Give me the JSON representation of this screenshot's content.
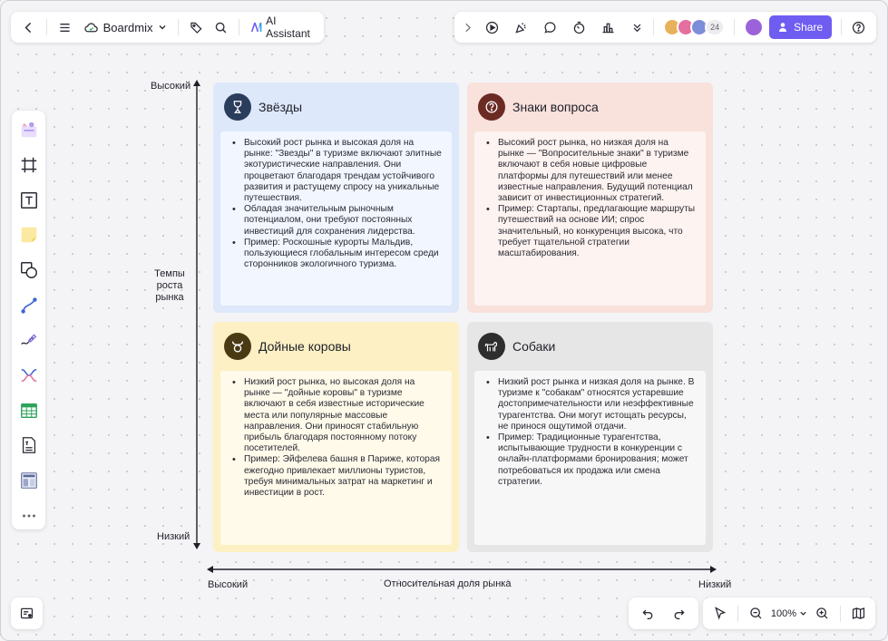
{
  "app": {
    "workspace": "Boardmix",
    "ai_label": "AI Assistant",
    "share_label": "Share",
    "collaborator_count": "24",
    "zoom": "100%",
    "colors": {
      "accent": "#6f5cf1"
    }
  },
  "toolbar_left": [
    {
      "name": "back-icon"
    },
    {
      "name": "menu-icon"
    },
    {
      "name": "cloud-icon"
    },
    {
      "name": "tag-icon"
    },
    {
      "name": "search-icon"
    },
    {
      "name": "ai-logo-icon"
    }
  ],
  "toolbar_right": [
    {
      "name": "chevron-right-icon"
    },
    {
      "name": "play-icon"
    },
    {
      "name": "celebrate-icon"
    },
    {
      "name": "comment-icon"
    },
    {
      "name": "timer-icon"
    },
    {
      "name": "vote-icon"
    },
    {
      "name": "chevron-down-double-icon"
    },
    {
      "name": "help-icon"
    }
  ],
  "sidebar_tools": [
    "templates-icon",
    "frame-icon",
    "text-icon",
    "sticky-note-icon",
    "shapes-icon",
    "connector-icon",
    "pen-icon",
    "mindmap-icon",
    "table-icon",
    "document-icon",
    "layout-icon",
    "more-icon"
  ],
  "matrix": {
    "y_axis": {
      "label": "Темпы\nроста\nрынка",
      "top": "Высокий",
      "bottom": "Низкий"
    },
    "x_axis": {
      "label": "Относительная доля рынка",
      "left": "Высокий",
      "right": "Низкий"
    },
    "quadrants": [
      {
        "key": "stars",
        "title": "Звёзды",
        "icon": "star-trophy-icon",
        "colors": {
          "bg": "#dde8fb",
          "card": "#f2f6fe",
          "icon_bg": "#2b3d5c"
        },
        "bullets": [
          "Высокий рост рынка и высокая доля на рынке: \"Звезды\" в туризме включают элитные экотуристические направления. Они процветают благодаря трендам устойчивого развития и растущему спросу на уникальные путешествия.",
          "Обладая значительным рыночным потенциалом, они требуют постоянных инвестиций для сохранения лидерства.",
          "Пример: Роскошные курорты Мальдив, пользующиеся глобальным интересом среди сторонников экологичного туризма."
        ]
      },
      {
        "key": "question-marks",
        "title": "Знаки вопроса",
        "icon": "question-icon",
        "colors": {
          "bg": "#f9e1dc",
          "card": "#fdf3f0",
          "icon_bg": "#6b2a24"
        },
        "bullets": [
          "Высокий рост рынка, но низкая доля на рынке — \"Вопросительные знаки\" в туризме включают в себя новые цифровые платформы для путешествий или менее известные направления. Будущий потенциал зависит от инвестиционных стратегий.",
          "Пример: Стартапы, предлагающие маршруты путешествий на основе ИИ; спрос значительный, но конкуренция высока, что требует тщательной стратегии масштабирования."
        ]
      },
      {
        "key": "cash-cows",
        "title": "Дойные коровы",
        "icon": "cow-icon",
        "colors": {
          "bg": "#fdf0c4",
          "card": "#fffaea",
          "icon_bg": "#4a3a14"
        },
        "bullets": [
          "Низкий рост рынка, но высокая доля на рынке — \"дойные коровы\" в туризме включают в себя известные исторические места или популярные массовые направления. Они приносят стабильную прибыль благодаря постоянному потоку посетителей.",
          "Пример: Эйфелева башня в Париже, которая ежегодно привлекает миллионы туристов, требуя минимальных затрат на маркетинг и инвестиции в рост."
        ]
      },
      {
        "key": "dogs",
        "title": "Собаки",
        "icon": "dog-icon",
        "colors": {
          "bg": "#e6e6e6",
          "card": "#f7f7f7",
          "icon_bg": "#2e2e2e"
        },
        "bullets": [
          "Низкий рост рынка и низкая доля на рынке. В туризме к \"собакам\" относятся устаревшие достопримечательности или неэффективные турагентства. Они могут истощать ресурсы, не принося ощутимой отдачи.",
          "Пример: Традиционные турагентства, испытывающие трудности в конкуренции с онлайн-платформами бронирования; может потребоваться их продажа или смена стратегии."
        ]
      }
    ]
  }
}
